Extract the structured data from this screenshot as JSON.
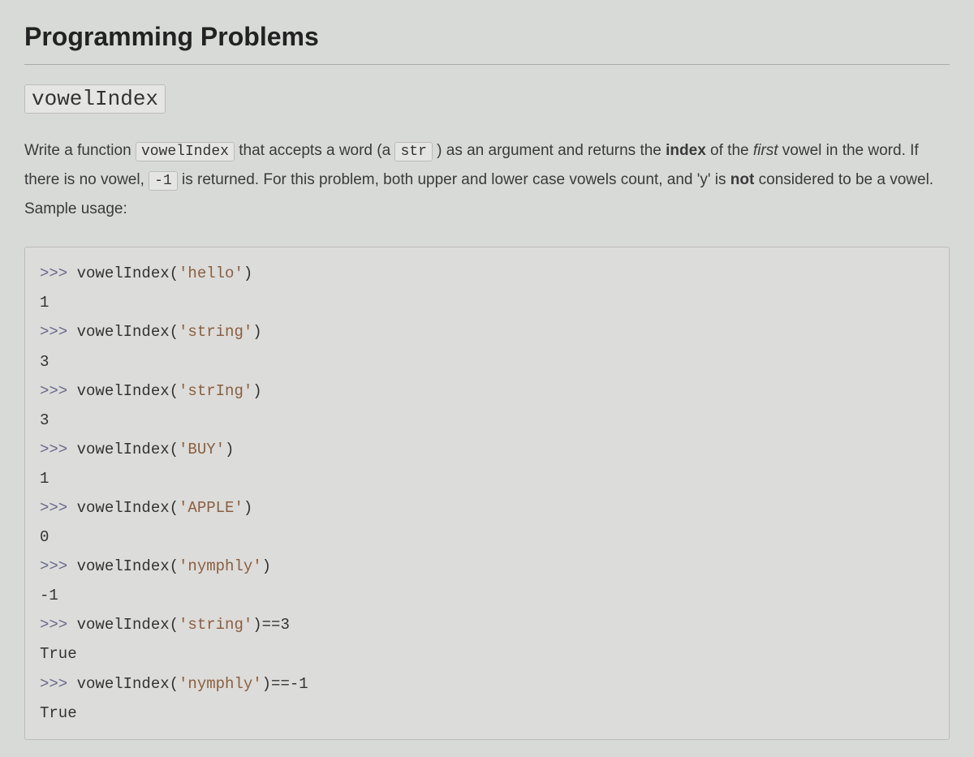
{
  "heading": "Programming Problems",
  "function_name": "vowelIndex",
  "description": {
    "p1_a": "Write a function ",
    "code1": "vowelIndex",
    "p1_b": " that accepts a word (a ",
    "code2": "str",
    "p1_c": " ) as an argument and returns the ",
    "bold1": "index",
    "p1_d": " of the ",
    "em1": "first",
    "p1_e": " vowel in the word.  If there is no vowel, ",
    "code3": "-1",
    "p1_f": " is returned.  For this problem, both upper and lower case vowels count, and 'y' is ",
    "bold2": "not",
    "p1_g": " considered to be a vowel.  Sample usage:"
  },
  "code_lines": [
    {
      "prompt": ">>> ",
      "call_fn": "vowelIndex(",
      "arg": "'hello'",
      "call_end": ")"
    },
    {
      "output": "1"
    },
    {
      "prompt": ">>> ",
      "call_fn": "vowelIndex(",
      "arg": "'string'",
      "call_end": ")"
    },
    {
      "output": "3"
    },
    {
      "prompt": ">>> ",
      "call_fn": "vowelIndex(",
      "arg": "'strIng'",
      "call_end": ")"
    },
    {
      "output": "3"
    },
    {
      "prompt": ">>> ",
      "call_fn": "vowelIndex(",
      "arg": "'BUY'",
      "call_end": ")"
    },
    {
      "output": "1"
    },
    {
      "prompt": ">>> ",
      "call_fn": "vowelIndex(",
      "arg": "'APPLE'",
      "call_end": ")"
    },
    {
      "output": "0"
    },
    {
      "prompt": ">>> ",
      "call_fn": "vowelIndex(",
      "arg": "'nymphly'",
      "call_end": ")"
    },
    {
      "output": "-1"
    },
    {
      "prompt": ">>> ",
      "call_fn": "vowelIndex(",
      "arg": "'string'",
      "call_end": ")==3"
    },
    {
      "output": "True"
    },
    {
      "prompt": ">>> ",
      "call_fn": "vowelIndex(",
      "arg": "'nymphly'",
      "call_end": ")==-1"
    },
    {
      "output": "True"
    }
  ]
}
